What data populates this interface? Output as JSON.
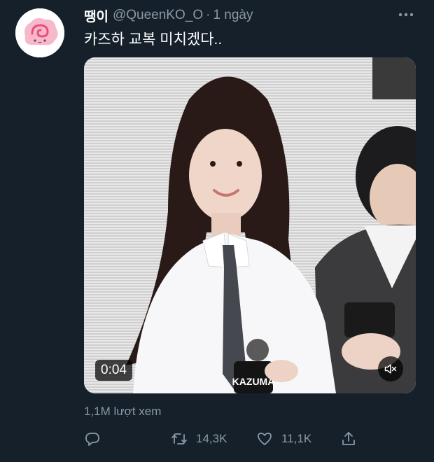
{
  "tweet": {
    "author": {
      "display_name": "땡이",
      "handle": "@QueenKO_O",
      "separator": "·",
      "time": "1 ngày",
      "avatar_icon": "pink-swirl-cloud-avatar"
    },
    "text": "카즈하 교복 미치겠다..",
    "more_icon": "more-dots-icon",
    "media": {
      "duration": "0:04",
      "mute_icon": "speaker-muted-icon",
      "logo_text": "KAZUMA"
    },
    "views": "1,1M lượt xem",
    "actions": {
      "reply": {
        "icon": "reply-icon",
        "count": ""
      },
      "retweet": {
        "icon": "retweet-icon",
        "count": "14,3K"
      },
      "like": {
        "icon": "heart-icon",
        "count": "11,1K"
      },
      "share": {
        "icon": "share-icon",
        "count": ""
      }
    }
  },
  "colors": {
    "background": "#15202b",
    "text_primary": "#ffffff",
    "text_secondary": "#8b98a5",
    "avatar_pink": "#f39ab7"
  }
}
